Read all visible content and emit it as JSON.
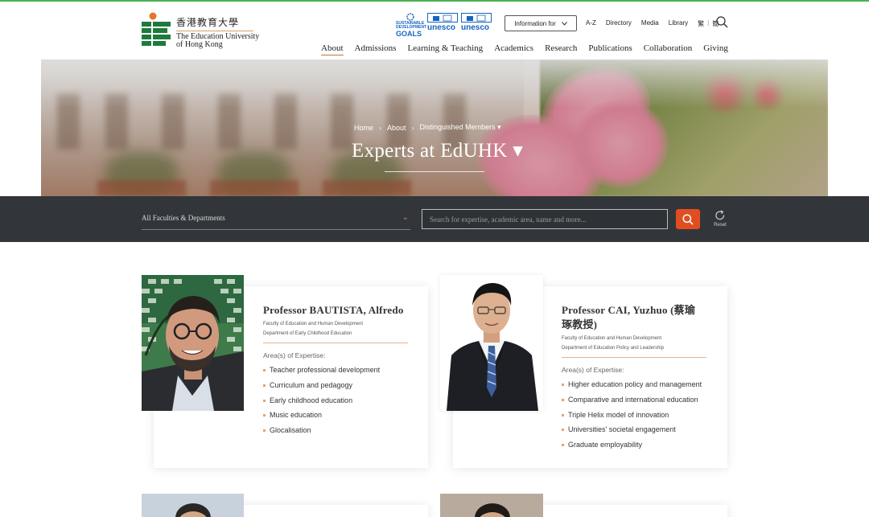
{
  "header": {
    "logo_zh": "香港教育大學",
    "logo_en_line1": "The Education University",
    "logo_en_line2": "of Hong Kong",
    "partners": {
      "sdg_line1": "SUSTAINABLE",
      "sdg_line2": "DEVELOPMENT",
      "sdg_goals": "GOALS",
      "unesco1_word": "unesco",
      "unesco2_word": "unesco"
    },
    "info_button": "Information for",
    "utilities": [
      "A-Z",
      "Directory",
      "Media",
      "Library",
      "繁",
      "簡"
    ],
    "nav": [
      "About",
      "Admissions",
      "Learning & Teaching",
      "Academics",
      "Research",
      "Publications",
      "Collaboration",
      "Giving"
    ],
    "active_nav": "About"
  },
  "hero": {
    "breadcrumb": [
      "Home",
      "About",
      "Distinguished Members ▾"
    ],
    "title": "Experts at EdUHK ▾"
  },
  "filters": {
    "faculty_value": "All Faculties & Departments",
    "search_placeholder": "Search for expertise, academic area, name and more...",
    "reset_label": "Reset"
  },
  "experts": [
    {
      "name": "Professor BAUTISTA, Alfredo",
      "faculty": "Faculty of Education and Human Development",
      "department": "Department of Early Childhood Education",
      "areas_label": "Area(s) of Expertise:",
      "areas": [
        "Teacher professional development",
        "Curriculum and pedagogy",
        "Early childhood education",
        "Music education",
        "Glocalisation"
      ]
    },
    {
      "name_line1": "Professor CAI, Yuzhuo (蔡瑜",
      "name_line2": "琢教授)",
      "faculty": "Faculty of Education and Human Development",
      "department": "Department of Education Policy and Leadership",
      "areas_label": "Area(s) of Expertise:",
      "areas": [
        "Higher education policy and management",
        "Comparative and international education",
        "Triple Helix model of innovation",
        "Universities' societal engagement",
        "Graduate employability"
      ]
    }
  ],
  "colors": {
    "accent_orange": "#e04e1f",
    "filter_bar": "#32363b",
    "logo_green": "#1e7a3c",
    "logo_orange": "#e8742a"
  }
}
